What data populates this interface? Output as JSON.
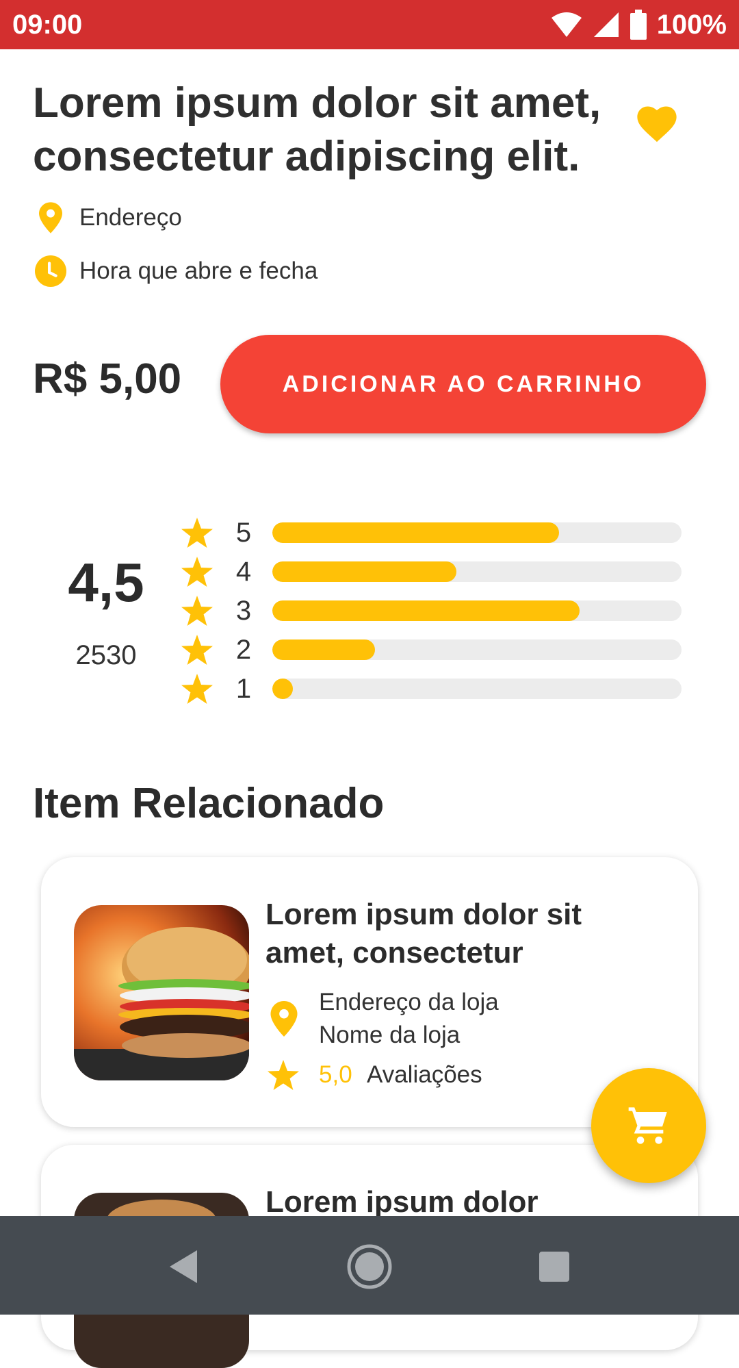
{
  "status_bar": {
    "time": "09:00",
    "battery": "100%"
  },
  "product": {
    "title": "Lorem ipsum dolor sit amet, consectetur adipiscing elit.",
    "address": "Endereço",
    "hours": "Hora que abre e fecha",
    "price": "R$ 5,00",
    "add_to_cart_label": "ADICIONAR AO CARRINHO"
  },
  "rating": {
    "average": "4,5",
    "count": "2530",
    "bars": [
      {
        "stars": "5",
        "fraction": 0.7
      },
      {
        "stars": "4",
        "fraction": 0.45
      },
      {
        "stars": "3",
        "fraction": 0.75
      },
      {
        "stars": "2",
        "fraction": 0.25
      },
      {
        "stars": "1",
        "fraction": 0.05
      }
    ]
  },
  "related": {
    "section_title": "Item Relacionado",
    "items": [
      {
        "title": "Lorem ipsum dolor sit amet, consectetur",
        "store_address": "Endereço da loja",
        "store_name": "Nome da loja",
        "rating": "5,0",
        "reviews_label": "Avaliações"
      },
      {
        "title": "Lorem ipsum dolor"
      }
    ]
  },
  "colors": {
    "status_bar": "#d32f2f",
    "accent": "#ffc107",
    "button": "#f44336",
    "nav_bar": "#454b51"
  },
  "icons": [
    "wifi-icon",
    "signal-icon",
    "battery-icon",
    "heart-icon",
    "location-pin-icon",
    "clock-icon",
    "star-icon",
    "cart-icon",
    "back-icon",
    "home-icon",
    "recents-icon"
  ]
}
